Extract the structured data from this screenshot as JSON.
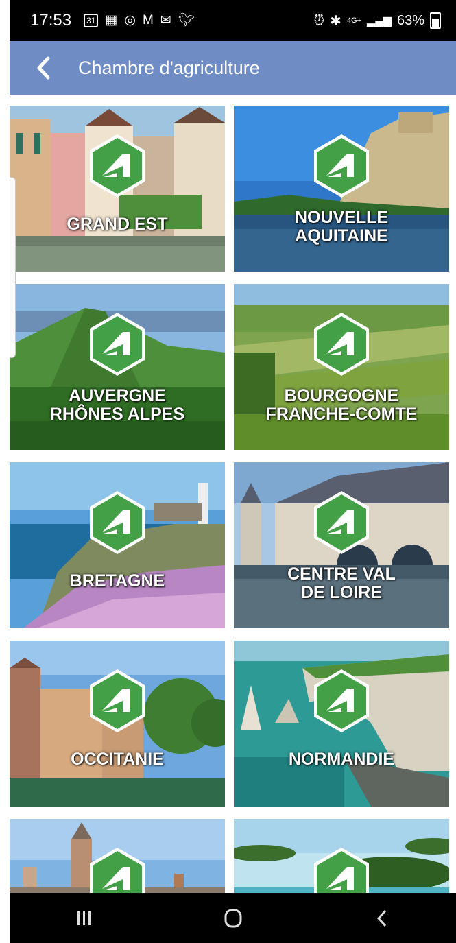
{
  "status_bar": {
    "time": "17:53",
    "left_icons": [
      "calendar-31-icon",
      "qr-code-icon",
      "instagram-icon",
      "gmail-icon",
      "mail-icon",
      "twitter-icon"
    ],
    "calendar_day": "31",
    "network": "4G+",
    "battery": "63%"
  },
  "app_bar": {
    "title": "Chambre d'agriculture",
    "color": "#6f8cc4"
  },
  "regions": [
    {
      "line1": "GRAND EST",
      "line2": "",
      "scene": "town"
    },
    {
      "line1": "NOUVELLE",
      "line2": "AQUITAINE",
      "scene": "cliff-river"
    },
    {
      "line1": "AUVERGNE",
      "line2": "RHÔNES ALPES",
      "scene": "volcano"
    },
    {
      "line1": "BOURGOGNE",
      "line2": "FRANCHE-COMTE",
      "scene": "vineyard"
    },
    {
      "line1": "BRETAGNE",
      "line2": "",
      "scene": "coast-flowers"
    },
    {
      "line1": "CENTRE VAL",
      "line2": "DE LOIRE",
      "scene": "castle"
    },
    {
      "line1": "OCCITANIE",
      "line2": "",
      "scene": "city-river"
    },
    {
      "line1": "NORMANDIE",
      "line2": "",
      "scene": "sea-cliffs"
    },
    {
      "line1": "",
      "line2": "",
      "scene": "belfry"
    },
    {
      "line1": "",
      "line2": "",
      "scene": "islands"
    }
  ],
  "badge_color": "#43a047",
  "nav": {
    "recent_icon": "recent-apps-icon",
    "home_icon": "home-icon",
    "back_icon": "back-icon"
  }
}
